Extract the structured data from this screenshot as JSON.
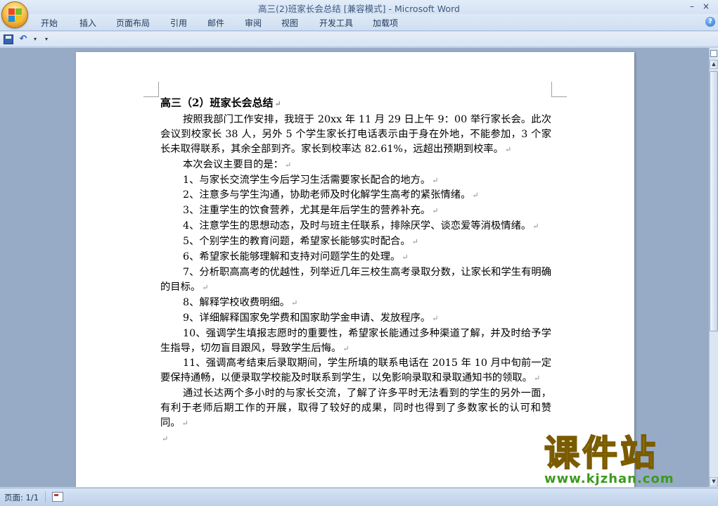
{
  "window": {
    "title": "高三(2)班家长会总结 [兼容模式] - Microsoft Word"
  },
  "ribbon": {
    "tabs": [
      "开始",
      "插入",
      "页面布局",
      "引用",
      "邮件",
      "审阅",
      "视图",
      "开发工具",
      "加载项"
    ]
  },
  "document": {
    "title": "高三（2）班家长会总结",
    "paragraphs": [
      "按照我部门工作安排，我班于 20xx 年 11 月 29 日上午 9：00 举行家长会。此次会议到校家长 38 人，另外 5 个学生家长打电话表示由于身在外地，不能参加，3 个家长未取得联系，其余全部到齐。家长到校率达 82.61%，远超出预期到校率。",
      "本次会议主要目的是：",
      "1、与家长交流学生今后学习生活需要家长配合的地方。",
      "2、注意多与学生沟通，协助老师及时化解学生高考的紧张情绪。",
      "3、注重学生的饮食营养，尤其是年后学生的营养补充。",
      "4、注意学生的思想动态，及时与班主任联系，排除厌学、谈恋爱等消极情绪。",
      "5、个别学生的教育问题，希望家长能够实时配合。",
      "6、希望家长能够理解和支持对问题学生的处理。",
      "7、分析职高高考的优越性，列举近几年三校生高考录取分数，让家长和学生有明确的目标。",
      "8、解释学校收费明细。",
      "9、详细解释国家免学费和国家助学金申请、发放程序。",
      "10、强调学生填报志愿时的重要性，希望家长能通过多种渠道了解，并及时给予学生指导，切勿盲目跟风，导致学生后悔。",
      "11、强调高考结束后录取期间，学生所填的联系电话在 2015 年 10 月中旬前一定要保持通畅，以便录取学校能及时联系到学生，以免影响录取和录取通知书的领取。",
      "通过长达两个多小时的与家长交流，了解了许多平时无法看到的学生的另外一面，有利于老师后期工作的开展，取得了较好的成果，同时也得到了多数家长的认可和赞同。",
      ""
    ],
    "paragraph_mark": "↵"
  },
  "watermark": {
    "text": "课件站",
    "url": "www.kjzhan.com"
  },
  "status": {
    "page": "页面: 1/1"
  },
  "qat": {
    "undo_symbol": "↶",
    "dropdown_symbol": "▾"
  },
  "controls": {
    "minimize": "–",
    "close": "×",
    "help": "?",
    "scroll_up": "▲",
    "scroll_down": "▼"
  },
  "colors": {
    "title_blue": "#3e5a80",
    "watermark_yellow": "#f2e300",
    "watermark_green": "#3c9a1e"
  }
}
